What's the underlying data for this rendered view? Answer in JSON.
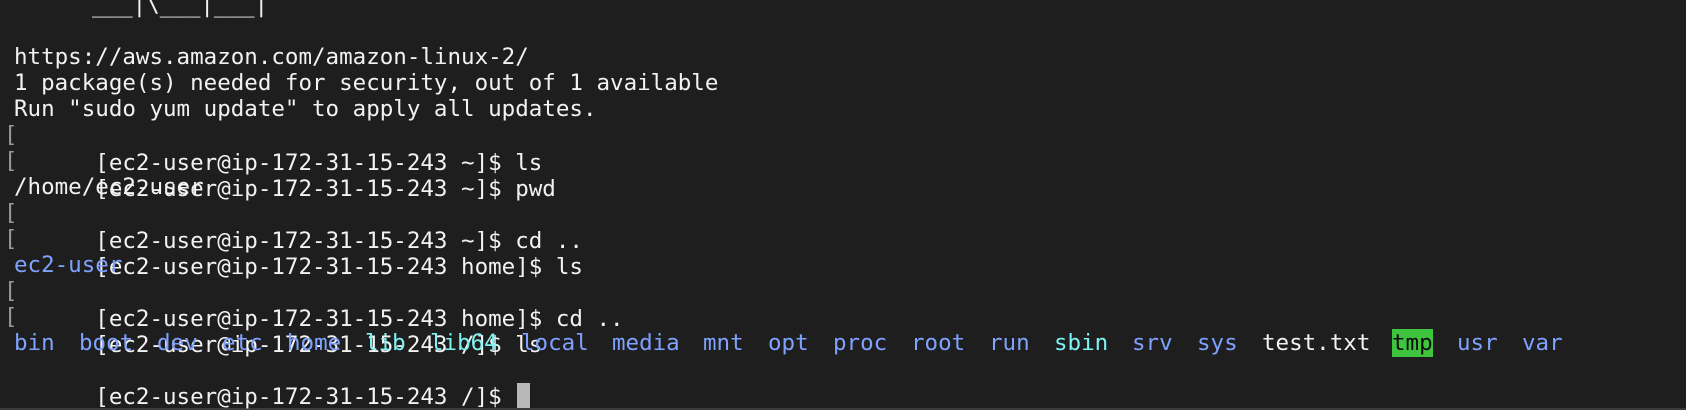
{
  "terminal": {
    "banner_art": "___|\\___|___|",
    "motd": [
      "https://aws.amazon.com/amazon-linux-2/",
      "1 package(s) needed for security, out of 1 available",
      "Run \"sudo yum update\" to apply all updates."
    ],
    "history": [
      {
        "prompt": "[ec2-user@ip-172-31-15-243 ~]$ ",
        "command": "ls"
      },
      {
        "prompt": "[ec2-user@ip-172-31-15-243 ~]$ ",
        "command": "pwd"
      },
      {
        "output": "/home/ec2-user"
      },
      {
        "prompt": "[ec2-user@ip-172-31-15-243 ~]$ ",
        "command": "cd .."
      },
      {
        "prompt": "[ec2-user@ip-172-31-15-243 home]$ ",
        "command": "ls"
      },
      {
        "output_dir": "ec2-user"
      },
      {
        "prompt": "[ec2-user@ip-172-31-15-243 home]$ ",
        "command": "cd .."
      },
      {
        "prompt": "[ec2-user@ip-172-31-15-243 /]$ ",
        "command": "ls"
      }
    ],
    "root_listing": [
      {
        "name": "bin",
        "kind": "dir"
      },
      {
        "name": "boot",
        "kind": "dir"
      },
      {
        "name": "dev",
        "kind": "dir"
      },
      {
        "name": "etc",
        "kind": "dir"
      },
      {
        "name": "home",
        "kind": "dir"
      },
      {
        "name": "lib",
        "kind": "link"
      },
      {
        "name": "lib64",
        "kind": "link"
      },
      {
        "name": "local",
        "kind": "dir"
      },
      {
        "name": "media",
        "kind": "dir"
      },
      {
        "name": "mnt",
        "kind": "dir"
      },
      {
        "name": "opt",
        "kind": "dir"
      },
      {
        "name": "proc",
        "kind": "dir"
      },
      {
        "name": "root",
        "kind": "dir"
      },
      {
        "name": "run",
        "kind": "dir"
      },
      {
        "name": "sbin",
        "kind": "link"
      },
      {
        "name": "srv",
        "kind": "dir"
      },
      {
        "name": "sys",
        "kind": "dir"
      },
      {
        "name": "test.txt",
        "kind": "file"
      },
      {
        "name": "tmp",
        "kind": "sticky"
      },
      {
        "name": "usr",
        "kind": "dir"
      },
      {
        "name": "var",
        "kind": "dir"
      }
    ],
    "current_prompt": "[ec2-user@ip-172-31-15-243 /]$ "
  },
  "colors": {
    "background": "#1e1e1e",
    "text": "#f2f2f2",
    "directory": "#7fa2ff",
    "symlink": "#7ff2f2",
    "sticky_bg": "#3ec43e",
    "cursor": "#b8b8b8"
  }
}
